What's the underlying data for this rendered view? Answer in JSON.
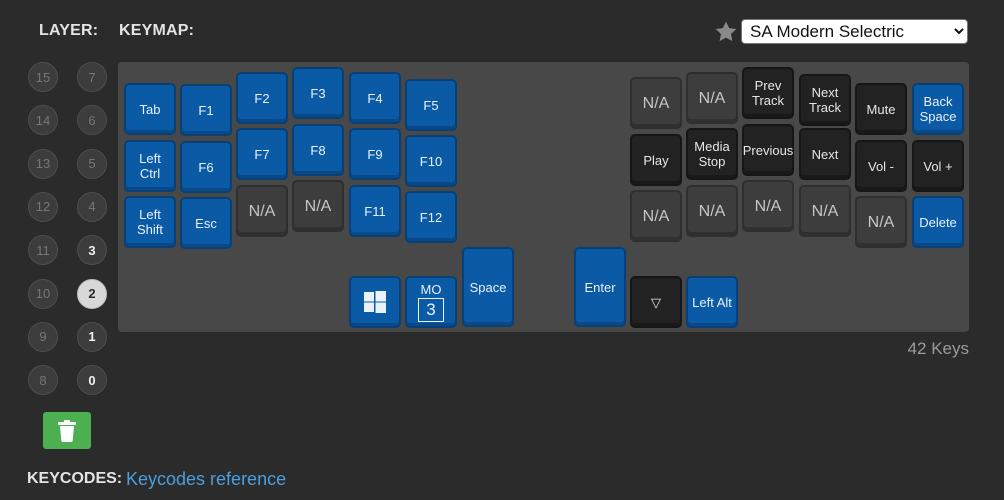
{
  "header": {
    "layer_label": "LAYER:",
    "keymap_label": "KEYMAP:"
  },
  "keyset": {
    "selected": "SA Modern Selectric",
    "favorite_icon": "star-icon"
  },
  "layers": [
    {
      "label": "15",
      "state": "empty"
    },
    {
      "label": "7",
      "state": "empty"
    },
    {
      "label": "14",
      "state": "empty"
    },
    {
      "label": "6",
      "state": "empty"
    },
    {
      "label": "13",
      "state": "empty"
    },
    {
      "label": "5",
      "state": "empty"
    },
    {
      "label": "12",
      "state": "empty"
    },
    {
      "label": "4",
      "state": "empty"
    },
    {
      "label": "11",
      "state": "empty"
    },
    {
      "label": "3",
      "state": "used"
    },
    {
      "label": "10",
      "state": "empty"
    },
    {
      "label": "2",
      "state": "active"
    },
    {
      "label": "9",
      "state": "empty"
    },
    {
      "label": "1",
      "state": "used"
    },
    {
      "label": "8",
      "state": "empty"
    },
    {
      "label": "0",
      "state": "used"
    }
  ],
  "delete_layer_icon": "trash-icon",
  "keys": [
    {
      "label": "Tab",
      "style": "blue"
    },
    {
      "label": "F1",
      "style": "blue"
    },
    {
      "label": "F2",
      "style": "blue"
    },
    {
      "label": "F3",
      "style": "blue"
    },
    {
      "label": "F4",
      "style": "blue"
    },
    {
      "label": "F5",
      "style": "blue"
    },
    {
      "label": "Left\nCtrl",
      "style": "blue"
    },
    {
      "label": "F6",
      "style": "blue"
    },
    {
      "label": "F7",
      "style": "blue"
    },
    {
      "label": "F8",
      "style": "blue"
    },
    {
      "label": "F9",
      "style": "blue"
    },
    {
      "label": "F10",
      "style": "blue"
    },
    {
      "label": "Left\nShift",
      "style": "blue"
    },
    {
      "label": "Esc",
      "style": "blue"
    },
    {
      "label": "N/A",
      "style": "gray"
    },
    {
      "label": "N/A",
      "style": "gray"
    },
    {
      "label": "F11",
      "style": "blue"
    },
    {
      "label": "F12",
      "style": "blue"
    },
    {
      "label": "",
      "style": "blue",
      "icon": "windows-logo-icon"
    },
    {
      "label": "MO",
      "style": "blue",
      "layer": "3"
    },
    {
      "label": "Space",
      "style": "blue"
    },
    {
      "label": "N/A",
      "style": "gray"
    },
    {
      "label": "N/A",
      "style": "gray"
    },
    {
      "label": "Prev\nTrack",
      "style": "dark"
    },
    {
      "label": "Next\nTrack",
      "style": "dark"
    },
    {
      "label": "Mute",
      "style": "dark"
    },
    {
      "label": "Back\nSpace",
      "style": "blue"
    },
    {
      "label": "Play",
      "style": "dark"
    },
    {
      "label": "Media\nStop",
      "style": "dark"
    },
    {
      "label": "Previous",
      "style": "dark"
    },
    {
      "label": "Next",
      "style": "dark"
    },
    {
      "label": "Vol -",
      "style": "dark"
    },
    {
      "label": "Vol +",
      "style": "dark"
    },
    {
      "label": "N/A",
      "style": "gray"
    },
    {
      "label": "N/A",
      "style": "gray"
    },
    {
      "label": "N/A",
      "style": "gray"
    },
    {
      "label": "N/A",
      "style": "gray"
    },
    {
      "label": "N/A",
      "style": "gray"
    },
    {
      "label": "Delete",
      "style": "blue"
    },
    {
      "label": "Enter",
      "style": "blue"
    },
    {
      "label": "▽",
      "style": "dark"
    },
    {
      "label": "Left Alt",
      "style": "blue"
    }
  ],
  "key_count": "42 Keys",
  "keycodes": {
    "label": "KEYCODES:",
    "link_text": "Keycodes reference"
  },
  "colors": {
    "key_blue": "#0b5aa6",
    "key_dark": "#222222",
    "key_gray": "#3d3d3d",
    "delete_green": "#4caf50",
    "link": "#4a9fe0"
  }
}
